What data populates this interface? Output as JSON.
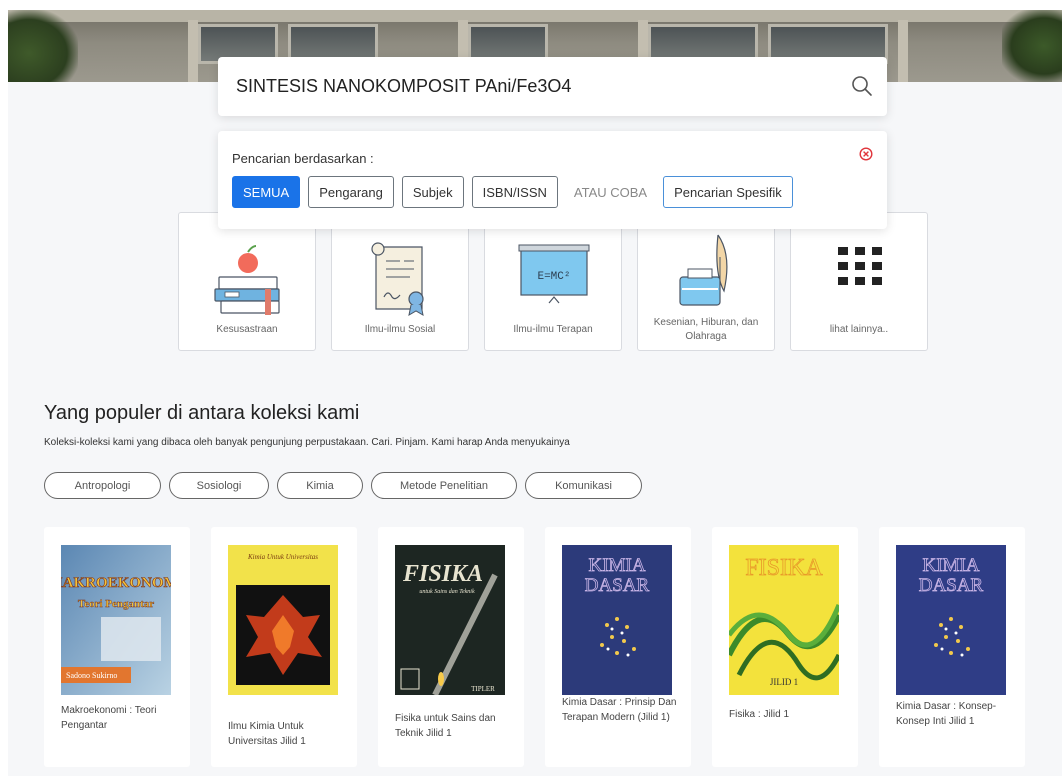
{
  "search": {
    "value": "SINTESIS NANOKOMPOSIT PAni/Fe3O4"
  },
  "filter": {
    "title": "Pencarian berdasarkan :",
    "options": [
      "SEMUA",
      "Pengarang",
      "Subjek",
      "ISBN/ISSN"
    ],
    "or_text": "ATAU COBA",
    "specific_label": "Pencarian Spesifik"
  },
  "categories": [
    {
      "label": "Kesusastraan",
      "icon": "books-apple-icon"
    },
    {
      "label": "Ilmu-ilmu Sosial",
      "icon": "certificate-scroll-icon"
    },
    {
      "label": "Ilmu-ilmu Terapan",
      "icon": "chalkboard-formula-icon"
    },
    {
      "label": "Kesenian, Hiburan, dan Olahraga",
      "icon": "ink-quill-icon"
    },
    {
      "label": "lihat lainnya..",
      "icon": "grid-icon"
    }
  ],
  "chalkboard_text": "E=MC²",
  "popular": {
    "title": "Yang populer di antara koleksi kami",
    "subtitle": "Koleksi-koleksi kami yang dibaca oleh banyak pengunjung perpustakaan. Cari. Pinjam. Kami harap Anda menyukainya",
    "tags": [
      "Antropologi",
      "Sosiologi",
      "Kimia",
      "Metode Penelitian",
      "Komunikasi"
    ]
  },
  "books": [
    {
      "caption": "Makroekonomi : Teori Pengantar",
      "cover_title": "MAKROEKONOMI",
      "cover_sub": "Teori Pengantar",
      "cover_author": "Sadono Sukirno"
    },
    {
      "caption": "Ilmu Kimia Untuk Universitas Jilid 1",
      "cover_title": "Kimia Untuk Universitas"
    },
    {
      "caption": "Fisika untuk Sains dan Teknik Jilid 1",
      "cover_title": "FISIKA",
      "cover_sub": "untuk Sains dan Teknik",
      "cover_author": "TIPLER"
    },
    {
      "caption": "Kimia Dasar : Prinsip Dan Terapan Modern (Jilid 1)",
      "cover_title": "KIMIA",
      "cover_sub": "DASAR"
    },
    {
      "caption": "Fisika : Jilid 1",
      "cover_title": "FISIKA",
      "cover_sub": "JILID 1"
    },
    {
      "caption": "Kimia Dasar : Konsep-Konsep Inti Jilid 1",
      "cover_title": "KIMIA",
      "cover_sub": "DASAR"
    }
  ],
  "colors": {
    "primary": "#1a73e8",
    "close_icon": "#e0353b",
    "page_background": "#f6f7f9"
  }
}
